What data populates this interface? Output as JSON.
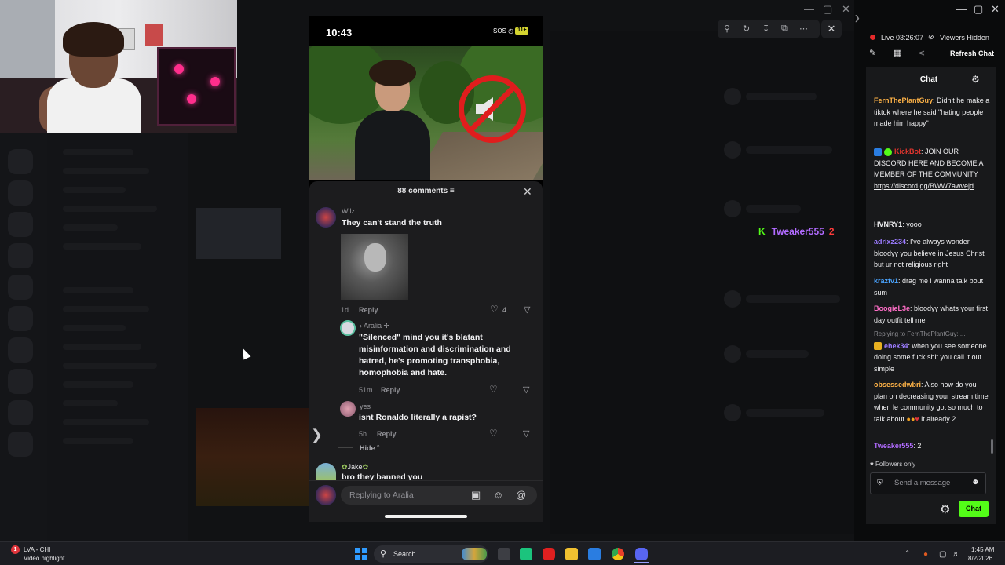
{
  "phone": {
    "time": "10:43",
    "status_signal": "SOS",
    "battery": "11+"
  },
  "comments_panel": {
    "title": "88 comments",
    "comments": [
      {
        "name": "Wilz",
        "text": "They can't stand the truth",
        "time": "1d",
        "reply": "Reply",
        "likes": "4"
      },
      {
        "name": "Aralia",
        "text": "\"Silenced\" mind you it's blatant misinformation and discrimination and hatred, he's promoting transphobia, homophobia and hate.",
        "time": "51m",
        "reply": "Reply"
      },
      {
        "name": "yes",
        "text": "isnt Ronaldo literally a rapist?",
        "time": "5h",
        "reply": "Reply"
      }
    ],
    "hide_label": "Hide",
    "next_comment_name": "Jake",
    "next_comment_text": "bro they banned you",
    "reply_placeholder": "Replying to  Aralia"
  },
  "alert": {
    "username": "Tweaker555",
    "count": "2"
  },
  "stream": {
    "live_label": "Live 03:26:07",
    "viewers_label": "Viewers Hidden",
    "refresh_label": "Refresh Chat"
  },
  "chat": {
    "title": "Chat",
    "messages": [
      {
        "user": "FernThePlantGuy",
        "color": "#ffb347",
        "text": ": Didn't he make a tiktok where he said \"hating people made him happy\""
      },
      {
        "user": "KickBot",
        "color": "#e2352e",
        "text": ": JOIN OUR DISCORD HERE AND BECOME A MEMBER OF THE COMMUNITY",
        "link": "https://discord.gg/BWW7awvejd"
      },
      {
        "user": "HVNRY1",
        "color": "#efeff1",
        "text": ": yooo"
      },
      {
        "user": "adrixz234",
        "color": "#9b7bff",
        "text": ": I've always wonder bloodyy you believe in Jesus Christ but ur not religious right"
      },
      {
        "user": "krazfv1",
        "color": "#4aa4ff",
        "text": ": drag me i wanna talk bout sum"
      },
      {
        "user": "BoogieL3e",
        "color": "#ff6ec7",
        "text": ": bloodyy whats your first day outfit tell me"
      },
      {
        "user": "ehek34",
        "color": "#9b7bff",
        "text": ": when you see someone doing some fuck shit you call it out simple",
        "reply_to": "Replying to FernThePlantGuy: ..."
      },
      {
        "user": "obsessedwbri",
        "color": "#ffb347",
        "text": ": Also how do you plan on decreasing your stream time when le community got so much to talk about",
        "suffix": " it already 2"
      },
      {
        "user": "Tweaker555",
        "color": "#b16bff",
        "text": ": 2"
      }
    ],
    "followers_only": "Followers only",
    "send_placeholder": "Send a message",
    "chat_button": "Chat"
  },
  "taskbar": {
    "alert_title": "LVA - CHI",
    "alert_sub": "Video highlight",
    "alert_badge": "1",
    "search_label": "Search",
    "time": "1:45 AM",
    "date": "8/2/2026"
  }
}
